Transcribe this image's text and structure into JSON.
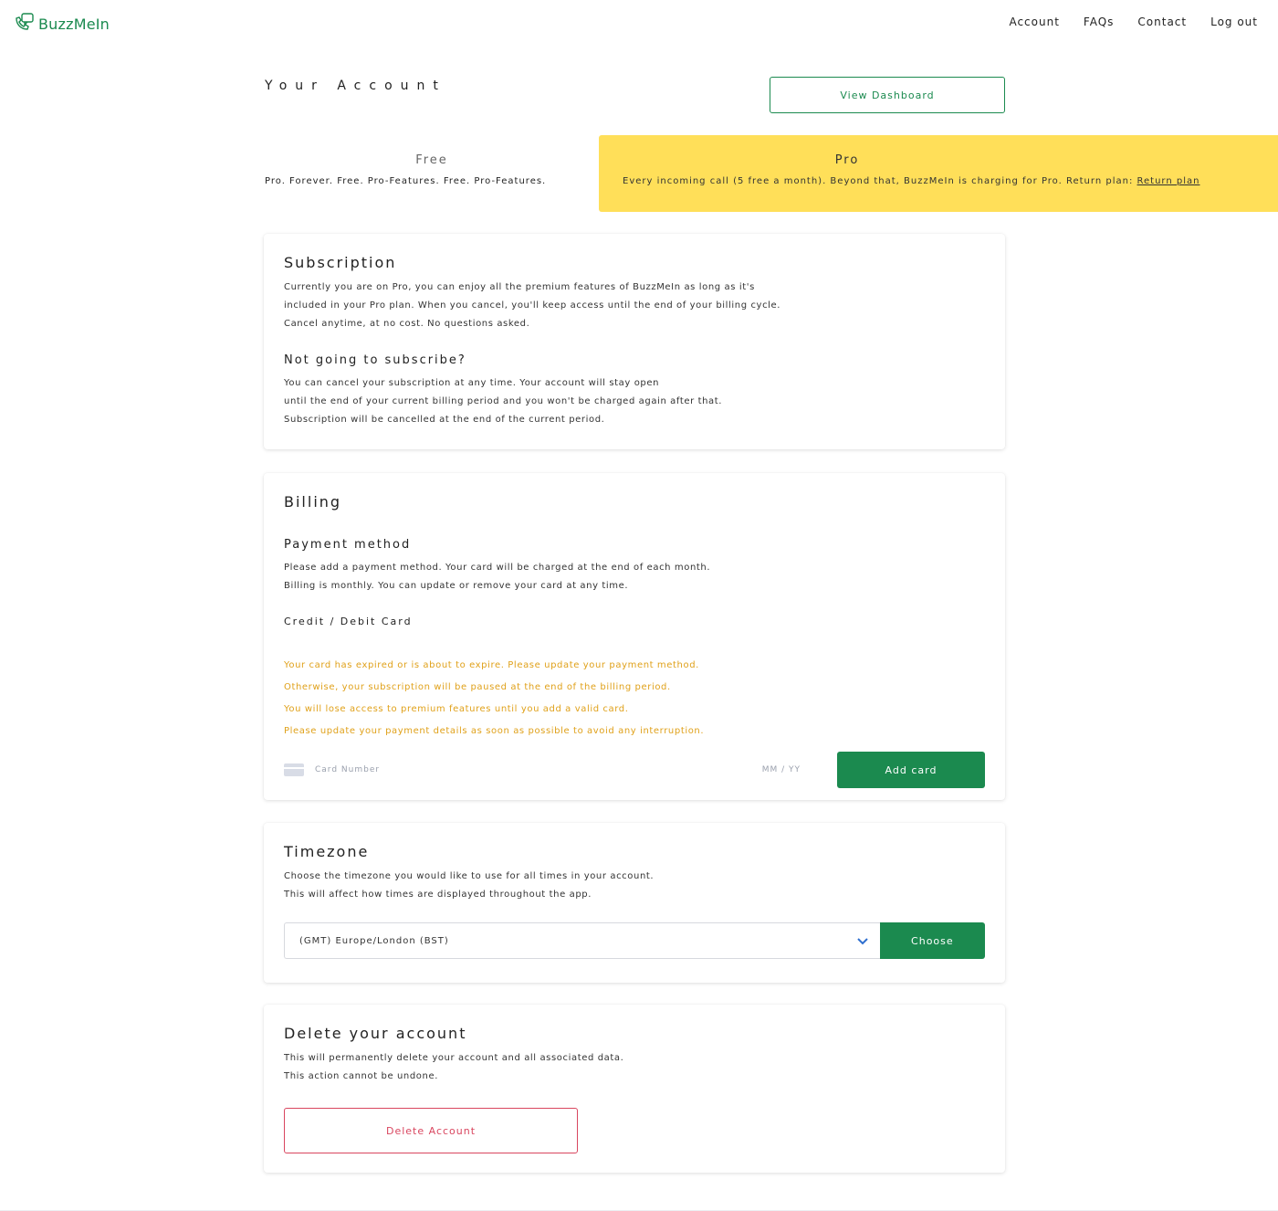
{
  "brand": {
    "name": "BuzzMeIn",
    "icon": "chat-phone-icon",
    "color": "#1b8a4f"
  },
  "nav": {
    "items": [
      "Account",
      "FAQs",
      "Contact",
      "Log out"
    ]
  },
  "header": {
    "title": "Your Account",
    "dashboard_button": "View Dashboard"
  },
  "plans": {
    "free": {
      "name": "Free",
      "description": "Pro. Forever. Free. Pro-Features. Free. Pro-Features."
    },
    "current": {
      "name": "Pro",
      "description": "Every incoming call (5 free a month). Beyond that, BuzzMeIn is charging for Pro. Return plan: ",
      "link": "Return plan"
    }
  },
  "subscription": {
    "title": "Subscription",
    "body": [
      "Currently you are on Pro, you can enjoy all the premium features of BuzzMeIn as long as it's",
      "included in your Pro plan. When you cancel, you'll keep access until the end of your billing cycle.",
      "Cancel anytime, at no cost. No questions asked."
    ],
    "section_title": "Not going to subscribe?",
    "section_body": [
      "You can cancel your subscription at any time. Your account will stay open",
      "until the end of your current billing period and you won't be charged again after that.",
      "Subscription will be cancelled at the end of the current period."
    ]
  },
  "billing": {
    "title": "Billing",
    "method_title": "Payment method",
    "method_body": [
      "Please add a payment method. Your card will be charged at the end of each month.",
      "Billing is monthly. You can update or remove your card at any time."
    ],
    "card_label": "Credit / Debit Card",
    "warning": [
      "Your card has expired or is about to expire. Please update your payment method.",
      "Otherwise, your subscription will be paused at the end of the billing period.",
      "You will lose access to premium features until you add a valid card.",
      "Please update your payment details as soon as possible to avoid any interruption."
    ],
    "warning_color": "#e0a11a",
    "card_number": "Card Number",
    "card_expiry": "MM / YY",
    "add_button": "Add card"
  },
  "timezone": {
    "title": "Timezone",
    "body": [
      "Choose the timezone you would like to use for all times in your account.",
      "This will affect how times are displayed throughout the app."
    ],
    "selected": "(GMT) Europe/London (BST)",
    "choose_button": "Choose"
  },
  "delete": {
    "title": "Delete your account",
    "body": [
      "This will permanently delete your account and all associated data.",
      "This action cannot be undone."
    ],
    "button": "Delete Account",
    "button_color": "#d9465f"
  }
}
